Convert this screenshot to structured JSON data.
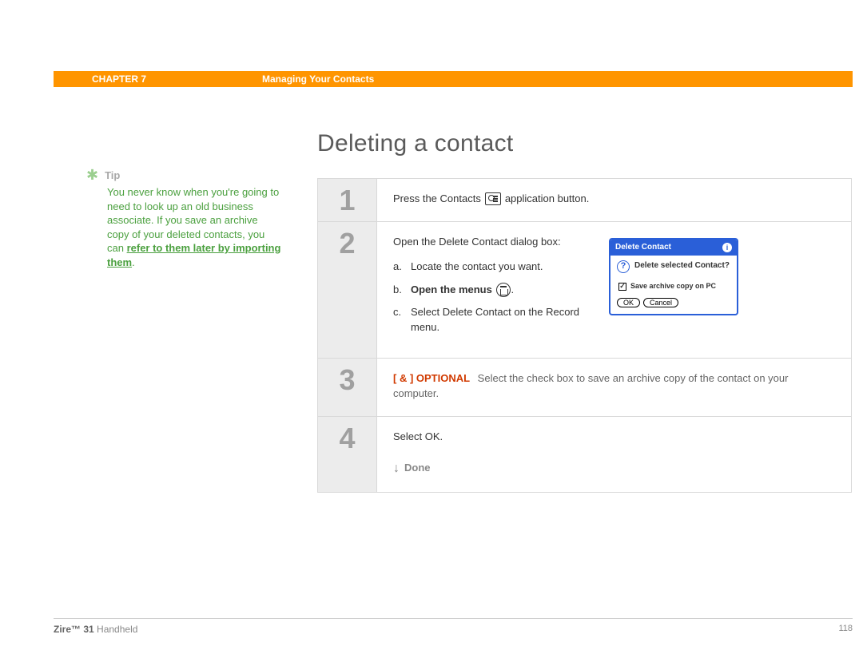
{
  "header": {
    "chapter": "CHAPTER 7",
    "section": "Managing Your Contacts"
  },
  "sidebar": {
    "tip_label": "Tip",
    "tip_body": "You never know when you're going to need to look up an old business associate. If you save an archive copy of your deleted contacts, you can ",
    "tip_link": "refer to them later by importing them",
    "tip_period": "."
  },
  "main": {
    "title": "Deleting a contact",
    "steps": {
      "s1": {
        "num": "1",
        "part1": "Press the Contacts",
        "part2": "application button."
      },
      "s2": {
        "num": "2",
        "intro": "Open the Delete Contact dialog box:",
        "a_letter": "a.",
        "a_text": "Locate the contact you want.",
        "b_letter": "b.",
        "b_text": "Open the menus",
        "b_period": ".",
        "c_letter": "c.",
        "c_text": "Select Delete Contact on the Record menu."
      },
      "s3": {
        "num": "3",
        "optional": "[ & ]  OPTIONAL",
        "text": "Select the check box to save an archive copy of the contact on your computer."
      },
      "s4": {
        "num": "4",
        "text": "Select OK.",
        "done": "Done"
      }
    },
    "dialog": {
      "title": "Delete Contact",
      "info": "i",
      "q": "?",
      "msg": "Delete selected Contact?",
      "check_label": "Save archive copy on PC",
      "ok": "OK",
      "cancel": "Cancel"
    }
  },
  "footer": {
    "product_bold": "Zire™ 31",
    "product_rest": " Handheld",
    "page": "118"
  }
}
